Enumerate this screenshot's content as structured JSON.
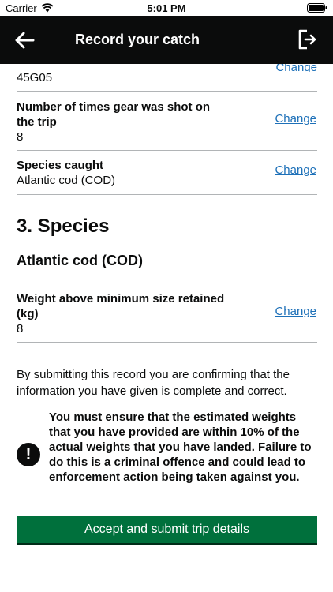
{
  "status_bar": {
    "carrier": "Carrier",
    "time": "5:01 PM"
  },
  "nav": {
    "title": "Record your catch",
    "back_icon": "arrow-left-icon",
    "exit_icon": "sign-out-icon"
  },
  "summary": {
    "partial_value": "45G05",
    "rows": [
      {
        "key": "Number of times gear was shot on the trip",
        "value": "8",
        "action": "Change"
      },
      {
        "key": "Species caught",
        "value": "Atlantic cod (COD)",
        "action": "Change"
      }
    ]
  },
  "section": {
    "heading": "3. Species",
    "species_name": "Atlantic cod (COD)",
    "rows": [
      {
        "key": "Weight above minimum size retained (kg)",
        "value": "8",
        "action": "Change"
      }
    ]
  },
  "declaration": "By submitting this record you are confirming that the information you have given is complete and correct.",
  "warning": {
    "icon": "!",
    "text": "You must ensure that the estimated weights that you have provided are within 10% of the actual weights that you have landed. Failure to do this is a criminal offence and could lead to enforcement action being taken against you."
  },
  "submit": {
    "label": "Accept and submit trip details"
  },
  "colors": {
    "nav_background": "#0b0c0c",
    "link": "#1d70b8",
    "button": "#00703c",
    "divider": "#b1b4b6"
  }
}
